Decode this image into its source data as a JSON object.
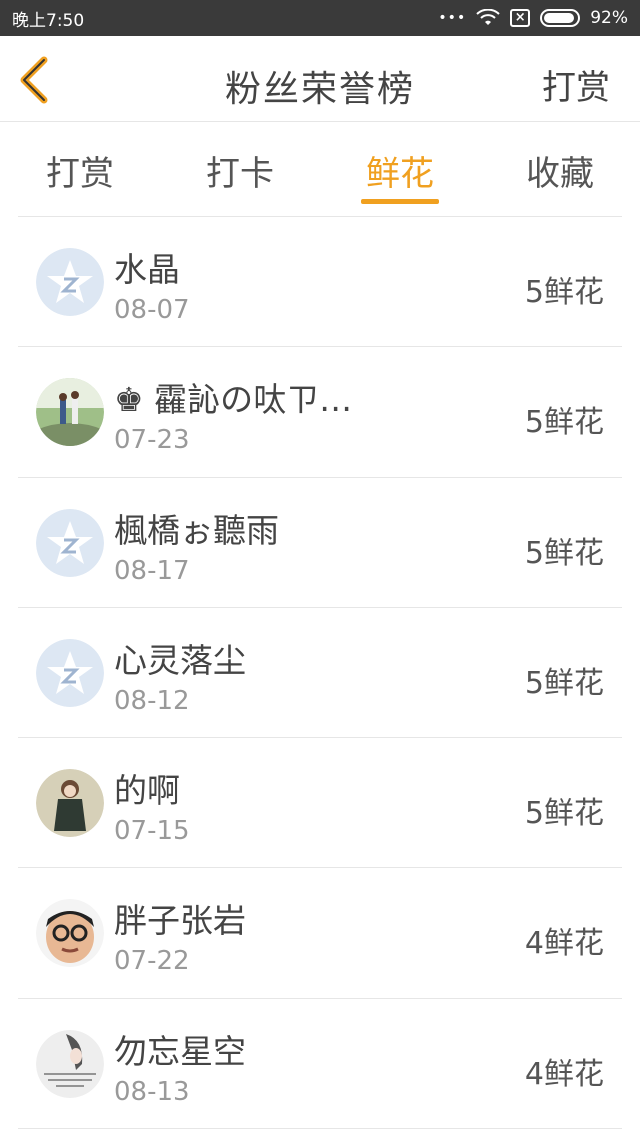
{
  "status_bar": {
    "time": "晚上7:50",
    "dots": "•••",
    "battery": "92%",
    "battery_level": 0.92
  },
  "nav": {
    "title": "粉丝荣誉榜",
    "action": "打赏",
    "accent_color": "#f0a020"
  },
  "tabs": [
    {
      "label": "打赏"
    },
    {
      "label": "打卡"
    },
    {
      "label": "鲜花",
      "active": true
    },
    {
      "label": "收藏"
    }
  ],
  "list": [
    {
      "name": "水晶",
      "date": "08-07",
      "amount": "5鲜花",
      "avatar": "default-qq-avatar"
    },
    {
      "name": "♚ 靃訫の呔ㄗ…",
      "date": "07-23",
      "amount": "5鲜花",
      "avatar": "couple-photo-avatar"
    },
    {
      "name": "楓橋ぉ聽雨",
      "date": "08-17",
      "amount": "5鲜花",
      "avatar": "default-qq-avatar"
    },
    {
      "name": "心灵落尘",
      "date": "08-12",
      "amount": "5鲜花",
      "avatar": "default-qq-avatar"
    },
    {
      "name": "的啊",
      "date": "07-15",
      "amount": "5鲜花",
      "avatar": "girl-dress-avatar"
    },
    {
      "name": "胖子张岩",
      "date": "07-22",
      "amount": "4鲜花",
      "avatar": "cartoon-man-avatar"
    },
    {
      "name": "勿忘星空",
      "date": "08-13",
      "amount": "4鲜花",
      "avatar": "girl-text-avatar"
    }
  ]
}
